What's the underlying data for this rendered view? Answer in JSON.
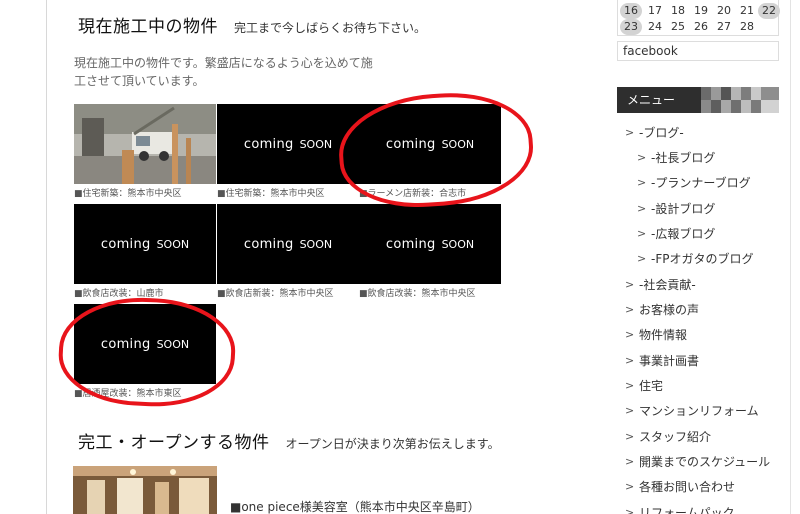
{
  "current": {
    "title": "現在施工中の物件",
    "subtitle": "完工まで今しばらくお待ち下さい。",
    "intro": "現在施工中の物件です。繁盛店になるよう心を込めて施工させて頂いています。",
    "coming_soon_main": "coming",
    "coming_soon_sub": "SOON",
    "tiles": [
      {
        "caption": "■住宅新築：熊本市中央区"
      },
      {
        "caption": "■住宅新築：熊本市中央区"
      },
      {
        "caption": "■ラーメン店新装：合志市"
      },
      {
        "caption": "■飲食店改装：山鹿市"
      },
      {
        "caption": "■飲食店新装：熊本市中央区"
      },
      {
        "caption": "■飲食店改装：熊本市中央区"
      },
      {
        "caption": "■居酒屋改装：熊本市東区"
      }
    ]
  },
  "completed": {
    "title": "完工・オープンする物件",
    "subtitle": "オープン日が決まり次第お伝えします。",
    "item_title": "■one piece様美容室（熊本市中央区辛島町）"
  },
  "sidebar": {
    "calendar": {
      "row1": [
        "16",
        "17",
        "18",
        "19",
        "20",
        "21",
        "22"
      ],
      "row2": [
        "23",
        "24",
        "25",
        "26",
        "27",
        "28"
      ]
    },
    "facebook_label": "facebook",
    "menu_heading": "メニュー",
    "menu": [
      {
        "label": "-ブログ-",
        "level": "top"
      },
      {
        "label": "-社長ブログ",
        "level": "sub"
      },
      {
        "label": "-プランナーブログ",
        "level": "sub"
      },
      {
        "label": "-設計ブログ",
        "level": "sub"
      },
      {
        "label": "-広報ブログ",
        "level": "sub"
      },
      {
        "label": "-FPオガタのブログ",
        "level": "sub"
      },
      {
        "label": "-社会貢献-",
        "level": "top"
      },
      {
        "label": "お客様の声",
        "level": "top"
      },
      {
        "label": "物件情報",
        "level": "top"
      },
      {
        "label": "事業計画書",
        "level": "top"
      },
      {
        "label": "住宅",
        "level": "top"
      },
      {
        "label": "マンションリフォーム",
        "level": "top"
      },
      {
        "label": "スタッフ紹介",
        "level": "top"
      },
      {
        "label": "開業までのスケジュール",
        "level": "top"
      },
      {
        "label": "各種お問い合わせ",
        "level": "top"
      },
      {
        "label": "リフォームパック",
        "level": "top"
      }
    ]
  },
  "colors": {
    "highlight_ring": "#e8141b",
    "tile_bg": "#000000",
    "menu_head_bg": "#2e2e2e"
  }
}
